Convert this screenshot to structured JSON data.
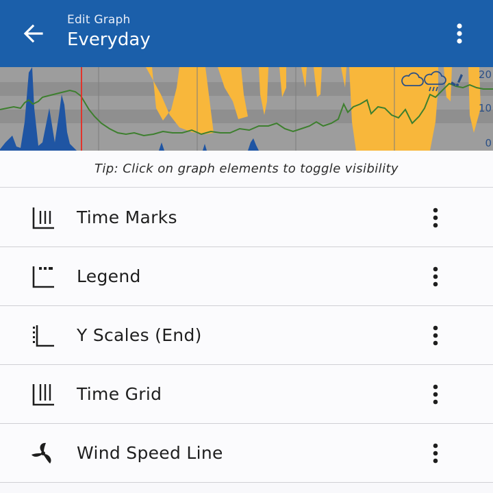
{
  "header": {
    "subtitle": "Edit Graph",
    "title": "Everyday",
    "back_icon": "arrow-left-icon",
    "menu_icon": "more-vertical-icon"
  },
  "graph": {
    "y_scale_labels": [
      "20",
      "10",
      "0"
    ],
    "weather_icons": [
      "cloud-icon",
      "rain-cloud-icon",
      "wind-icon"
    ],
    "colors": {
      "background": "#9b9b9b",
      "sun": "#f8b73b",
      "precipitation": "#1f55a3",
      "temperature_line": "#3d7f2e",
      "time_marker": "#e2332b"
    }
  },
  "tip": "Tip: Click on graph elements to toggle visibility",
  "items": [
    {
      "label": "Time Marks",
      "icon": "time-marks-icon"
    },
    {
      "label": "Legend",
      "icon": "legend-icon"
    },
    {
      "label": "Y Scales (End)",
      "icon": "y-scales-icon"
    },
    {
      "label": "Time Grid",
      "icon": "time-grid-icon"
    },
    {
      "label": "Wind Speed Line",
      "icon": "wind-turbine-icon"
    }
  ],
  "colors": {
    "appbar": "#1b5faa",
    "text": "#1e1e1e",
    "divider": "#cfcfd4"
  }
}
